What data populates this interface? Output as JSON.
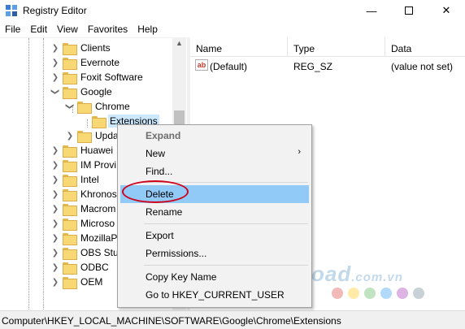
{
  "window": {
    "title": "Registry Editor",
    "app_icon": "registry-editor-icon"
  },
  "menubar": [
    "File",
    "Edit",
    "View",
    "Favorites",
    "Help"
  ],
  "tree": [
    {
      "label": "Clients",
      "expander": "chevron-right"
    },
    {
      "label": "Evernote",
      "expander": "chevron-right"
    },
    {
      "label": "Foxit Software",
      "expander": "chevron-right"
    },
    {
      "label": "Google",
      "expander": "chevron-down"
    },
    {
      "label": "Chrome",
      "expander": "chevron-down"
    },
    {
      "label": "Extensions",
      "expander": "none",
      "selected": true
    },
    {
      "label": "Upda",
      "expander": "chevron-right"
    },
    {
      "label": "Huawei",
      "expander": "chevron-right"
    },
    {
      "label": "IM Provi",
      "expander": "chevron-right"
    },
    {
      "label": "Intel",
      "expander": "chevron-right"
    },
    {
      "label": "Khronos",
      "expander": "chevron-right"
    },
    {
      "label": "Macrom",
      "expander": "chevron-right"
    },
    {
      "label": "Microso",
      "expander": "chevron-right"
    },
    {
      "label": "MozillaP",
      "expander": "chevron-right"
    },
    {
      "label": "OBS Stu",
      "expander": "chevron-right"
    },
    {
      "label": "ODBC",
      "expander": "chevron-right"
    },
    {
      "label": "OEM",
      "expander": "chevron-right"
    }
  ],
  "list": {
    "columns": [
      "Name",
      "Type",
      "Data"
    ],
    "rows": [
      {
        "name": "(Default)",
        "type": "REG_SZ",
        "data": "(value not set)",
        "icon": "string-value-icon"
      }
    ]
  },
  "context_menu": {
    "items": [
      {
        "label": "Expand",
        "disabled": true
      },
      {
        "label": "New",
        "submenu": true,
        "arrow": "›"
      },
      {
        "label": "Find..."
      },
      {
        "label": "Delete",
        "highlighted": true
      },
      {
        "label": "Rename"
      },
      {
        "label": "Export"
      },
      {
        "label": "Permissions..."
      },
      {
        "label": "Copy Key Name"
      },
      {
        "label": "Go to HKEY_CURRENT_USER"
      }
    ]
  },
  "status": {
    "path": "Computer\\HKEY_LOCAL_MACHINE\\SOFTWARE\\Google\\Chrome\\Extensions"
  },
  "watermark": {
    "main": "Download",
    "suffix": ".com.vn"
  },
  "colors": {
    "highlight": "#91c9f7",
    "selection": "#cce8ff",
    "annotation": "#d0021b",
    "folder": "#f8d775"
  }
}
